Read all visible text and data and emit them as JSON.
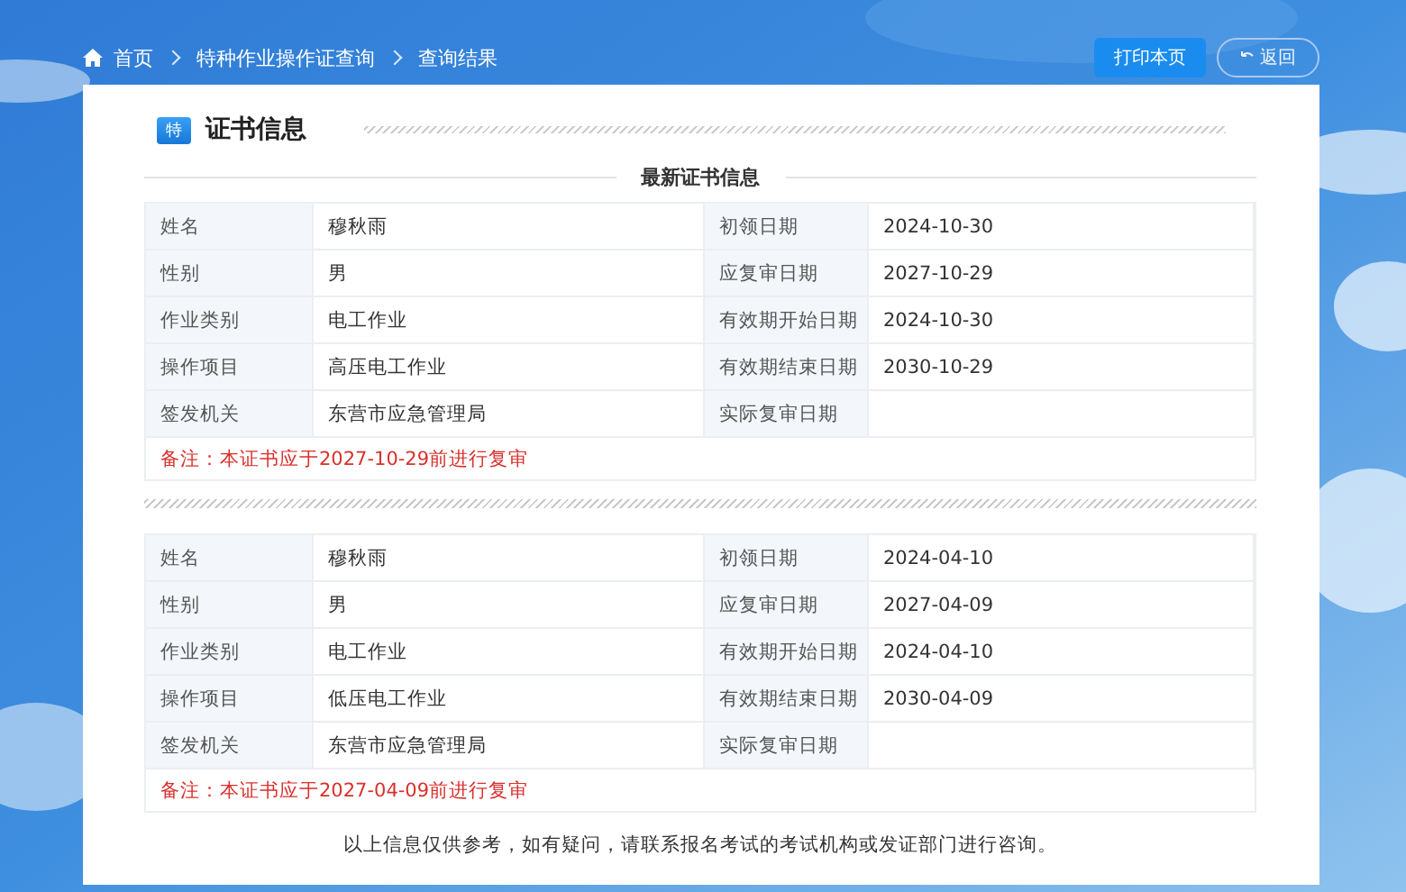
{
  "breadcrumb": [
    {
      "label": "首页",
      "kind": "home"
    },
    {
      "label": "特种作业操作证查询",
      "kind": "link"
    },
    {
      "label": "查询结果",
      "kind": "current"
    }
  ],
  "buttons": [
    {
      "label": "打印本页",
      "kind": "primary"
    },
    {
      "label": "返回",
      "kind": "back"
    }
  ],
  "section": {
    "badge": "特",
    "title": "证书信息"
  },
  "latest_heading": "最新证书信息",
  "certificates": [
    {
      "fields": [
        {
          "label": "姓名",
          "value": "穆秋雨"
        },
        {
          "label": "初领日期",
          "value": "2024-10-30"
        },
        {
          "label": "性别",
          "value": "男"
        },
        {
          "label": "应复审日期",
          "value": "2027-10-29"
        },
        {
          "label": "作业类别",
          "value": "电工作业"
        },
        {
          "label": "有效期开始日期",
          "value": "2024-10-30"
        },
        {
          "label": "操作项目",
          "value": "高压电工作业"
        },
        {
          "label": "有效期结束日期",
          "value": "2030-10-29"
        },
        {
          "label": "签发机关",
          "value": "东营市应急管理局"
        },
        {
          "label": "实际复审日期"
        }
      ],
      "note": "备注：本证书应于2027-10-29前进行复审"
    },
    {
      "fields": [
        {
          "label": "姓名",
          "value": "穆秋雨"
        },
        {
          "label": "初领日期",
          "value": "2024-04-10"
        },
        {
          "label": "性别",
          "value": "男"
        },
        {
          "label": "应复审日期",
          "value": "2027-04-09"
        },
        {
          "label": "作业类别",
          "value": "电工作业"
        },
        {
          "label": "有效期开始日期",
          "value": "2024-04-10"
        },
        {
          "label": "操作项目",
          "value": "低压电工作业"
        },
        {
          "label": "有效期结束日期",
          "value": "2030-04-09"
        },
        {
          "label": "签发机关",
          "value": "东营市应急管理局"
        },
        {
          "label": "实际复审日期"
        }
      ],
      "note": "备注：本证书应于2027-04-09前进行复审"
    }
  ],
  "footer_note": "以上信息仅供参考，如有疑问，请联系报名考试的考试机构或发证部门进行咨询。"
}
